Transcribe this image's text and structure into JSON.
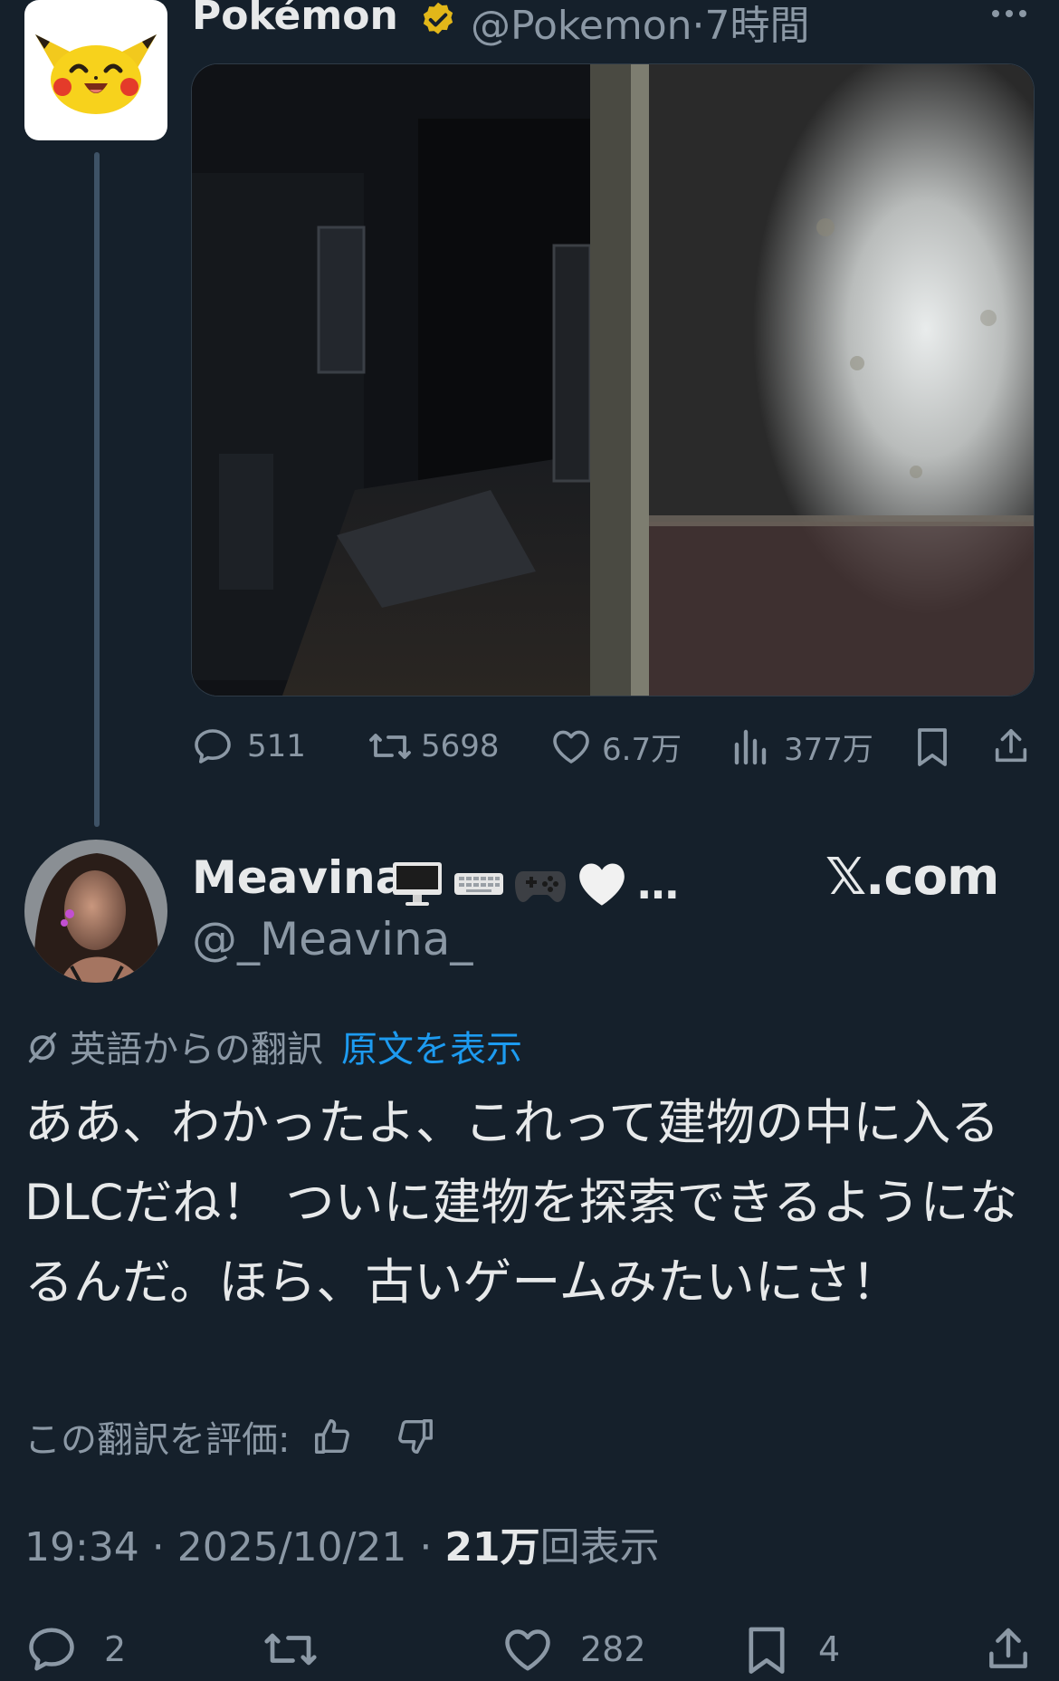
{
  "parent_tweet": {
    "display_name": "Pokémon",
    "handle": "@Pokemon",
    "time": "·7時間",
    "stats": {
      "replies": "511",
      "retweets": "5698",
      "likes": "6.7万",
      "views": "377万"
    }
  },
  "reply_tweet": {
    "display_name": "Meavina",
    "name_suffix": "…",
    "handle": "@_Meavina_",
    "watermark": "𝕏.com",
    "translation_label": "英語からの翻訳",
    "show_original": "原文を表示",
    "body": "ああ、わかったよ、これって建物の中に入るDLCだね！ ついに建物を探索できるようになるんだ。ほら、古いゲームみたいにさ！",
    "rate_translation": "この翻訳を評価:",
    "time": "19:34",
    "separator1": " · ",
    "date": "2025/10/21",
    "separator2": " · ",
    "views_count": "21万",
    "views_label": "回表示",
    "stats": {
      "replies": "2",
      "likes": "282",
      "bookmarks": "4"
    }
  },
  "colors": {
    "background": "#15202b",
    "text_primary": "#e7e9ea",
    "text_secondary": "#8b98a5",
    "link": "#1d9bf0",
    "verified_gold": "#e2b719"
  },
  "icons": [
    "verified-badge-icon",
    "more-icon",
    "reply-icon",
    "retweet-icon",
    "like-icon",
    "views-icon",
    "bookmark-icon",
    "share-icon",
    "translate-icon",
    "thumbs-up-icon",
    "thumbs-down-icon"
  ]
}
